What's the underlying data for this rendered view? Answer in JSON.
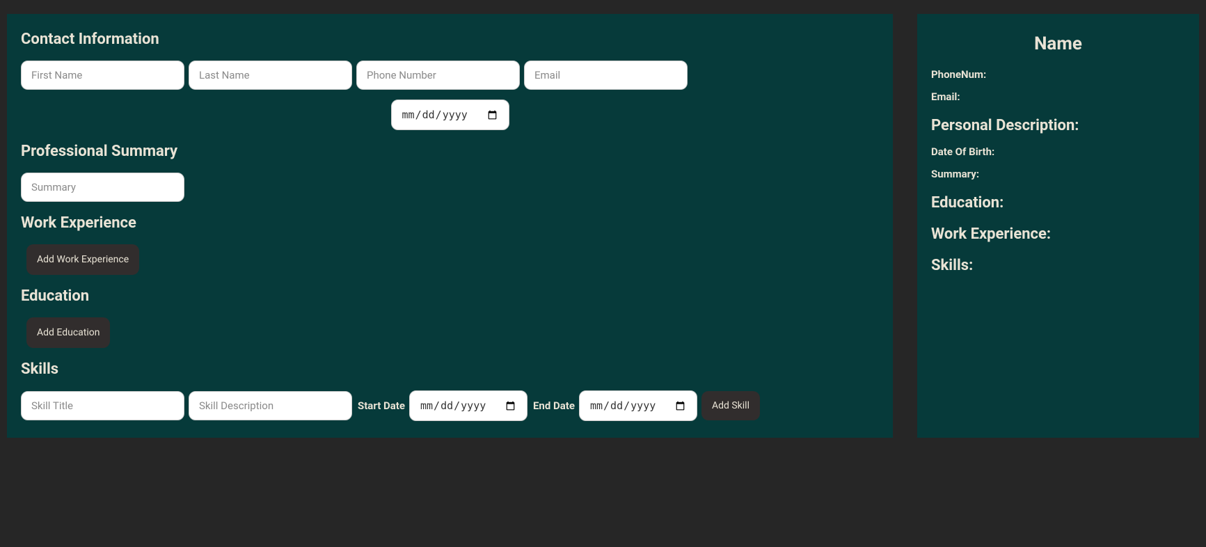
{
  "form": {
    "contact": {
      "heading": "Contact Information",
      "first_name_placeholder": "First Name",
      "last_name_placeholder": "Last Name",
      "phone_placeholder": "Phone Number",
      "email_placeholder": "Email",
      "date_placeholder": "mm/dd/yyyy"
    },
    "summary": {
      "heading": "Professional Summary",
      "summary_placeholder": "Summary"
    },
    "work": {
      "heading": "Work Experience",
      "add_button": "Add Work Experience"
    },
    "education": {
      "heading": "Education",
      "add_button": "Add Education"
    },
    "skills": {
      "heading": "Skills",
      "title_placeholder": "Skill Title",
      "description_placeholder": "Skill Description",
      "start_date_label": "Start Date",
      "end_date_label": "End Date",
      "add_button": "Add Skill"
    }
  },
  "preview": {
    "name_heading": "Name",
    "phone_label": "PhoneNum:",
    "email_label": "Email:",
    "personal_description_heading": "Personal Description:",
    "dob_label": "Date Of Birth:",
    "summary_label": "Summary:",
    "education_heading": "Education:",
    "work_heading": "Work Experience:",
    "skills_heading": "Skills:"
  }
}
